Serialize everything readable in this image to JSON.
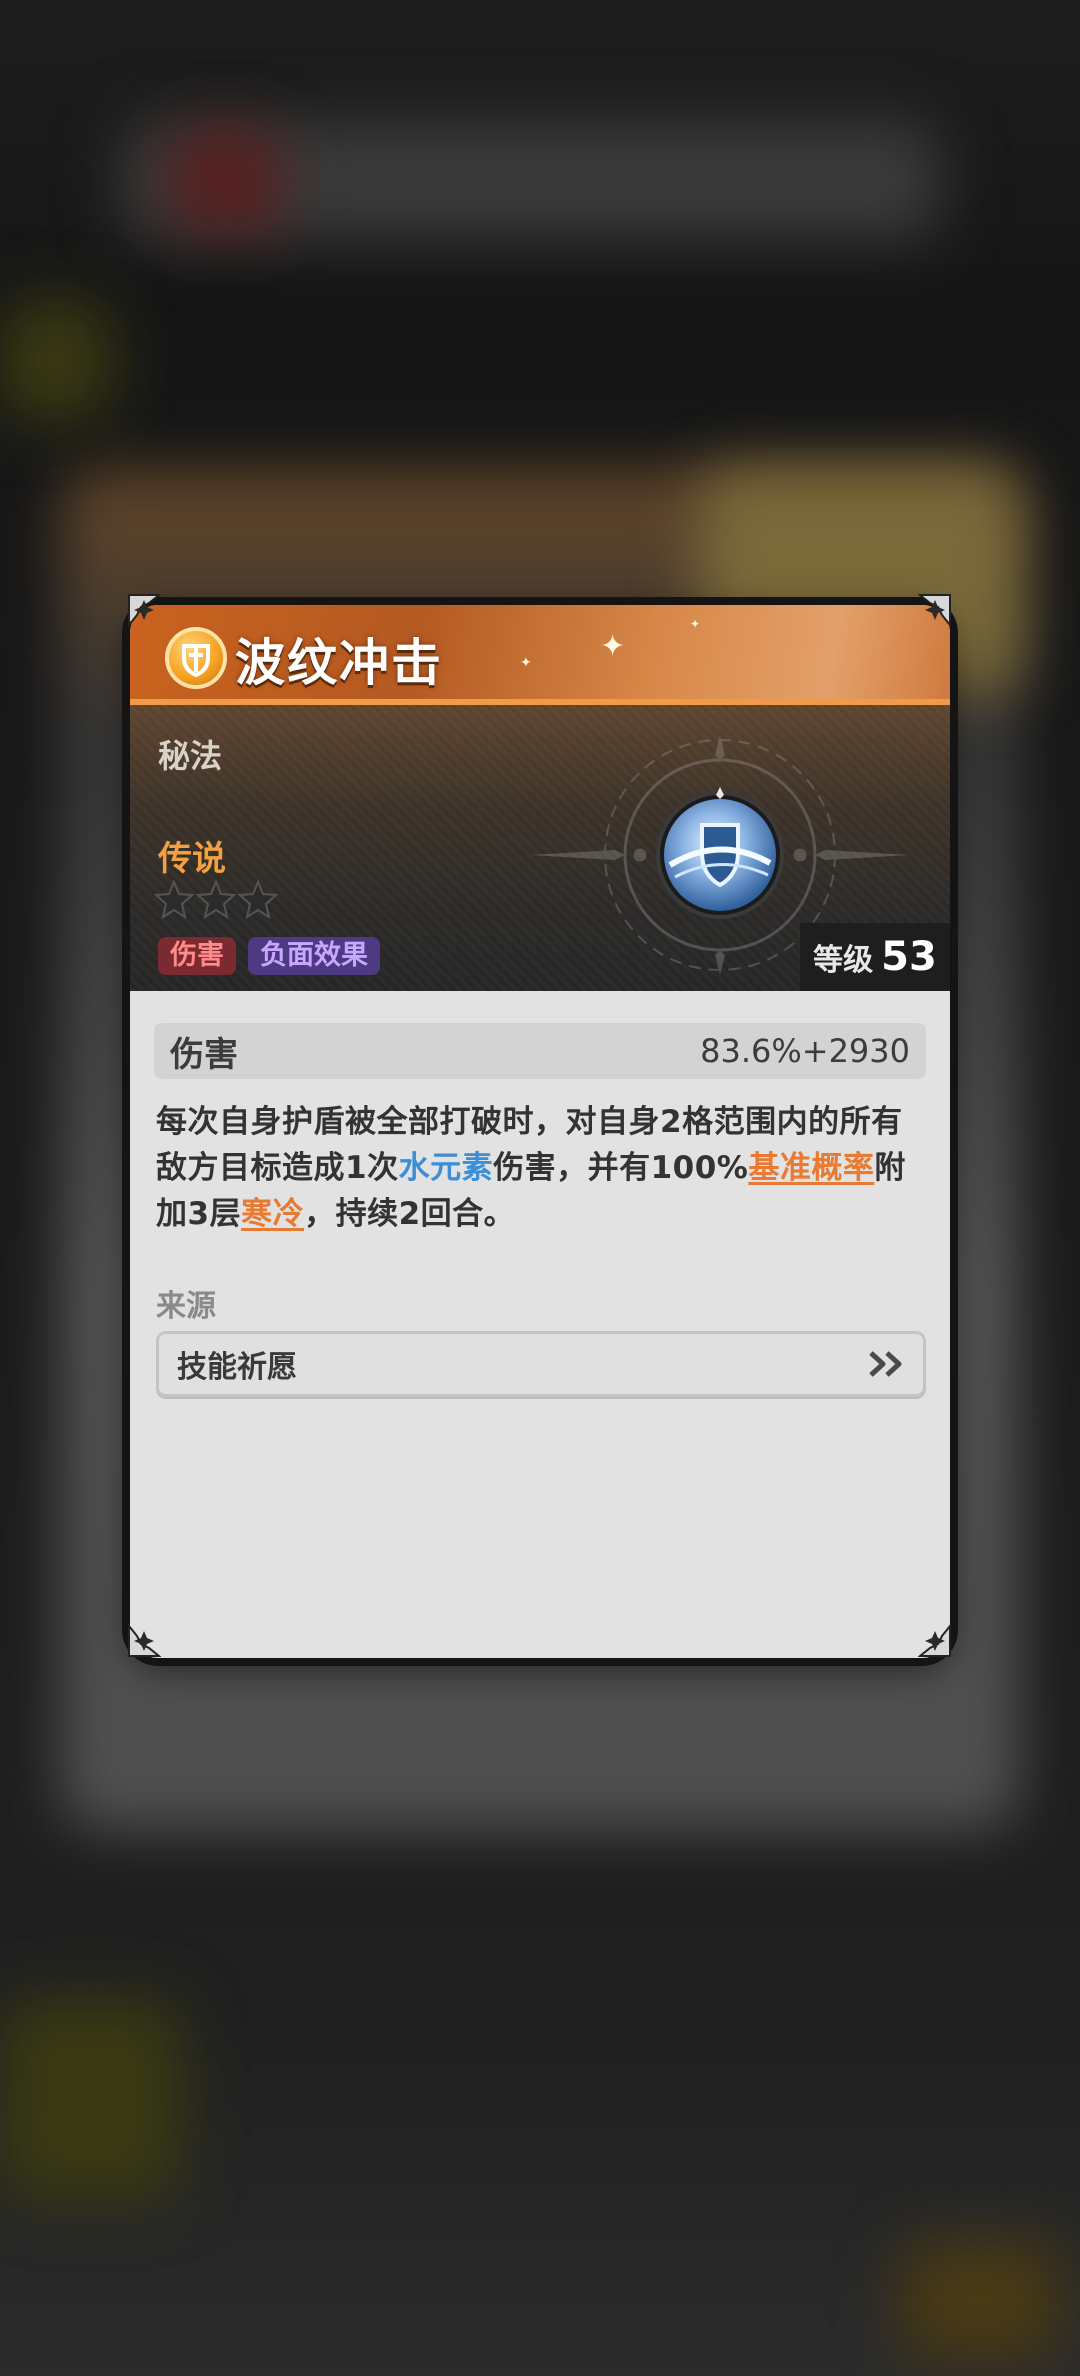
{
  "card": {
    "title": "波纹冲击",
    "type": "秘法",
    "rarity": "传说",
    "stars_filled": 0,
    "stars_total": 3,
    "tags": [
      "伤害",
      "负面效果"
    ],
    "level_label": "等级",
    "level_value": "53",
    "stat": {
      "name": "伤害",
      "value": "83.6%+2930"
    },
    "description": {
      "p1": "每次自身护盾被全部打破时，对自身2格范围内的所有敌方目标造成1次",
      "hl1": "水元素",
      "p2": "伤害，并有100%",
      "hl2": "基准概率",
      "p3": "附加3层",
      "hl3": "寒冷",
      "p4": "，持续2回合。"
    },
    "source_label": "来源",
    "source_button": "技能祈愿"
  },
  "icons": {
    "header": "shield-emblem-icon",
    "skill": "water-shield-icon",
    "corner": "corner-ornament-icon",
    "source": "double-chevron-right-icon"
  },
  "colors": {
    "header_orange": "#c9621e",
    "rarity_legend": "#f2a040",
    "keyword_water": "#3b8fd6",
    "keyword_orange": "#e87a32",
    "tag_damage": "#7a2a30",
    "tag_debuff": "#4d3a82"
  }
}
